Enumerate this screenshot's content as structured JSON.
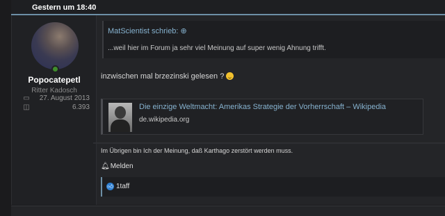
{
  "post": {
    "timestamp": "Gestern um 18:40",
    "author": {
      "username": "Popocatepetl",
      "title": "Ritter Kadosch",
      "joined": "27. August 2013",
      "messages": "6.393",
      "joined_icon": "calendar-icon",
      "messages_icon": "chat-bubbles-icon"
    },
    "quote": {
      "author_line": "MatScientist schrieb: ⊕",
      "text": "...weil hier im Forum ja sehr viel Meinung auf super wenig Ahnung trifft."
    },
    "message1": "inzwischen mal brzezinski gelesen ?",
    "link_card": {
      "title": "Die einzige Weltmacht: Amerikas Strategie der Vorherrschaft – Wikipedia",
      "domain": "de.wikipedia.org"
    },
    "message2": "Im Übrigen bin Ich der Meinung, daß Karthago zerstört werden muss.",
    "report_label": "Melden",
    "reactions": {
      "user": "1taff"
    }
  },
  "colors": {
    "accent": "#6d8fa6",
    "link": "#86b2cf",
    "online": "#3f8d2c",
    "like": "#2d7fd3"
  }
}
